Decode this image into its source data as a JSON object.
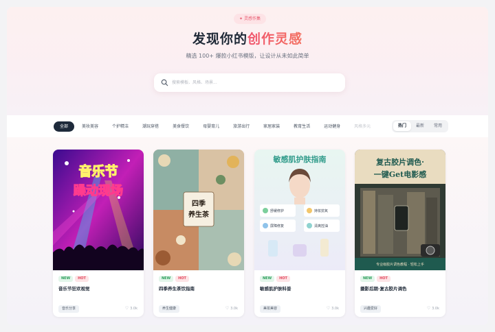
{
  "hero": {
    "badge": "灵感作集",
    "title_main": "发现你的",
    "title_accent": "创作灵感",
    "subtitle": "精选 100+ 爆款小红书模版，让设计从未如此简单"
  },
  "search": {
    "placeholder": "搜索模板、风格、场景..."
  },
  "categories": [
    "全部",
    "美妆美容",
    "个护精洁",
    "潮玩穿搭",
    "美食餐饮",
    "母婴育儿",
    "旅游出行",
    "家居家装",
    "教育生活",
    "运动健身",
    "风格多元"
  ],
  "active_category": "全部",
  "sort": {
    "options": [
      "热门",
      "最新",
      "常用"
    ],
    "selected": "热门"
  },
  "cards": [
    {
      "image_text": [
        "音乐节",
        "躁动现场"
      ],
      "tags": [
        "NEW",
        "HOT"
      ],
      "title": "音乐节狂欢视觉",
      "chip": "音乐分享",
      "likes": "3.0k"
    },
    {
      "image_text": [
        "四季",
        "养生茶"
      ],
      "tags": [
        "NEW",
        "HOT"
      ],
      "title": "四季养生茶饮指南",
      "chip": "养生健康",
      "likes": "3.0k"
    },
    {
      "image_text": [
        "敏感肌护肤指南",
        "舒缓修护",
        "持妆抗氧",
        "屏障修复",
        "清爽控油"
      ],
      "tags": [
        "NEW",
        "HOT"
      ],
      "title": "敏感肌护肤科普",
      "chip": "美妆美容",
      "likes": "3.0k"
    },
    {
      "image_text": [
        "复古胶片调色·",
        "一键Get电影感",
        "专业级胶片调色教程 · 轻松上手"
      ],
      "tags": [
        "NEW",
        "HOT"
      ],
      "title": "摄影后期·复古胶片调色",
      "chip": "兴趣爱好",
      "likes": "3.0k"
    }
  ],
  "colors": {
    "accent": "#f0556e",
    "active_chip": "#1e2a3b",
    "new_tag": "#2c9d5a",
    "hot_tag": "#e2495e"
  },
  "icons": [
    "sparkle-icon",
    "search-icon",
    "heart-icon"
  ]
}
